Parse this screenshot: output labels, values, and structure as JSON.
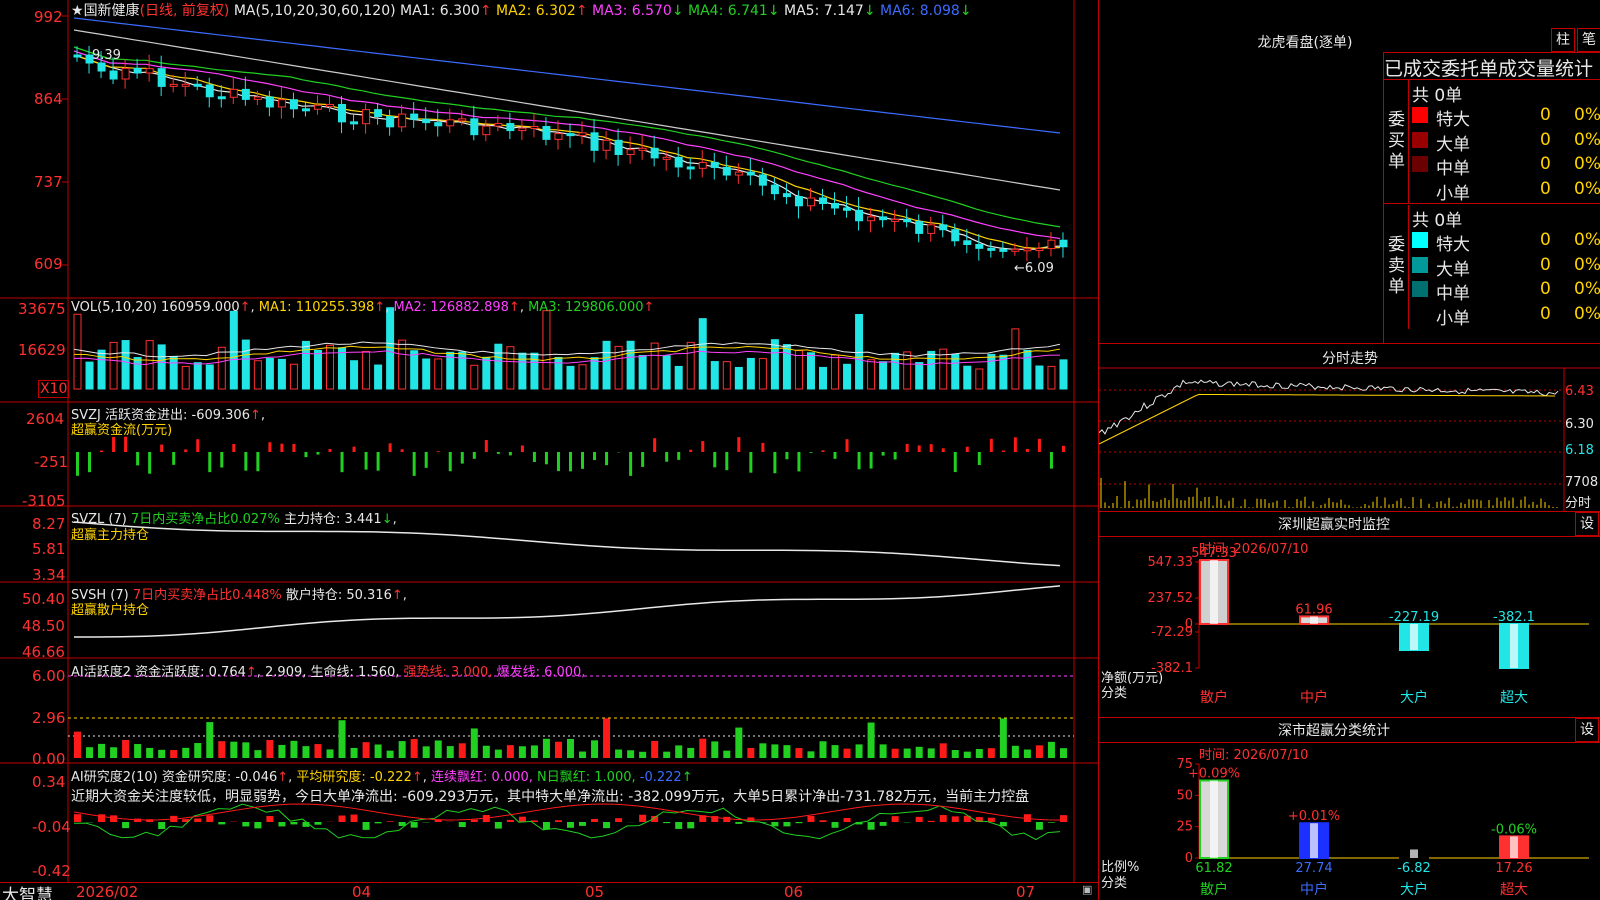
{
  "app": {
    "name": "大智慧",
    "stock_name": "国新健康",
    "period": "(日线, 前复权)"
  },
  "main_chart": {
    "ma_header": "MA(5,10,20,30,60,120)",
    "ma": [
      {
        "name": "MA1",
        "value": "6.300",
        "arrow": "↑",
        "color": "#e8e8e8"
      },
      {
        "name": "MA2",
        "value": "6.302",
        "arrow": "↑",
        "color": "#ffd400"
      },
      {
        "name": "MA3",
        "value": "6.570",
        "arrow": "↓",
        "color": "#ff40ff"
      },
      {
        "name": "MA4",
        "value": "6.741",
        "arrow": "↓",
        "color": "#21d021"
      },
      {
        "name": "MA5",
        "value": "7.147",
        "arrow": "↓",
        "color": "#e8e8e8"
      },
      {
        "name": "MA6",
        "value": "8.098",
        "arrow": "↓",
        "color": "#3c6cff"
      }
    ],
    "y_ticks": [
      "992",
      "864",
      "737",
      "609"
    ],
    "high_label": "9.39",
    "low_label": "←6.09"
  },
  "vol": {
    "header": "VOL(5,10,20)",
    "value": "160959.000",
    "ma1": "MA1: 110255.398",
    "ma2": "MA2: 126882.898",
    "ma3": "MA3: 129806.000",
    "y_ticks": [
      "33675",
      "16629"
    ],
    "unit": "X10"
  },
  "svzj": {
    "header": "SVZJ  活跃资金进出: -609.306",
    "sub": "超赢资金流(万元)",
    "y_ticks": [
      "2604",
      "-251",
      "-3105"
    ]
  },
  "svzl": {
    "header_a": "SVZL (7)",
    "header_b": "7日内买卖净占比0.027%",
    "header_c": "主力持仓: 3.441",
    "sub": "超赢主力持仓",
    "y_ticks": [
      "8.27",
      "5.81",
      "3.34"
    ]
  },
  "svsh": {
    "header_a": "SVSH (7)",
    "header_b": "7日内买卖净占比0.448%",
    "header_c": "散户持仓: 50.316",
    "sub": "超赢散户持仓",
    "y_ticks": [
      "50.40",
      "48.50",
      "46.66"
    ]
  },
  "ai_active": {
    "header_a": "AI活跃度2 资金活跃度: 0.764",
    "header_b": "2.909,",
    "header_c": "生命线: 1.560,",
    "header_d": "强势线: 3.000,",
    "header_e": "爆发线: 6.000,",
    "y_ticks": [
      "6.00",
      "2.96",
      "0.00"
    ]
  },
  "ai_research": {
    "header_a": "AI研究度2(10) 资金研究度: -0.046",
    "header_b": "平均研究度: -0.222",
    "header_c": "连续飘红: 0.000,",
    "header_d": "N日飘红: 1.000,",
    "header_e": "-0.222",
    "comment": "近期大资金关注度较低，明显弱势，今日大单净流出: -609.293万元，其中特大单净流出: -382.099万元，大单5日累计净出-731.782万元，当前主力控盘",
    "y_ticks": [
      "0.34",
      "-0.04",
      "-0.42"
    ]
  },
  "x_axis": [
    "2026/02",
    "04",
    "05",
    "06",
    "07"
  ],
  "longhu": {
    "title": "龙虎看盘(逐单)",
    "btn_zhu": "柱",
    "btn_bi": "笔",
    "subtitle": "已成交委托单成交量统计",
    "buy_label": "委买单",
    "sell_label": "委卖单",
    "buy_total": "共 0单",
    "sell_total": "共 0单",
    "buy_rows": [
      {
        "name": "特大",
        "count": "0",
        "pct": "0%",
        "color": "#ff0000"
      },
      {
        "name": "大单",
        "count": "0",
        "pct": "0%",
        "color": "#9a0000"
      },
      {
        "name": "中单",
        "count": "0",
        "pct": "0%",
        "color": "#6a0000"
      },
      {
        "name": "小单",
        "count": "0",
        "pct": "0%",
        "color": "#000000"
      }
    ],
    "sell_rows": [
      {
        "name": "特大",
        "count": "0",
        "pct": "0%",
        "color": "#00ffff"
      },
      {
        "name": "大单",
        "count": "0",
        "pct": "0%",
        "color": "#009a9a"
      },
      {
        "name": "中单",
        "count": "0",
        "pct": "0%",
        "color": "#007070"
      },
      {
        "name": "小单",
        "count": "0",
        "pct": "0%",
        "color": "#000000"
      }
    ]
  },
  "intraday": {
    "title": "分时走势",
    "y_ticks": [
      "6.43",
      "6.30",
      "6.18"
    ],
    "vol_tick": "7708",
    "vol_unit": "分时"
  },
  "sz_monitor": {
    "title": "深圳超赢实时监控",
    "btn": "设",
    "time": "时间: 2026/07/10",
    "y_ticks": [
      "547.33",
      "237.52",
      "0",
      "-72.29",
      "-382.1"
    ],
    "unit": "净额(万元)",
    "cat_label": "分类",
    "chart_data": {
      "type": "bar",
      "categories": [
        "散户",
        "中户",
        "大户",
        "超大"
      ],
      "values": [
        547.33,
        61.96,
        -227.19,
        -382.1
      ],
      "value_labels": [
        "547.33",
        "61.96",
        "-227.19",
        "-382.1"
      ],
      "ylim": [
        -382.1,
        547.33
      ]
    }
  },
  "sz_class": {
    "title": "深市超赢分类统计",
    "btn": "设",
    "time": "时间: 2026/07/10",
    "y_ticks": [
      "75",
      "50",
      "25",
      "0"
    ],
    "unit": "比例%",
    "cat_label": "分类",
    "chart_data": {
      "type": "bar",
      "categories": [
        "散户",
        "中户",
        "大户",
        "超大"
      ],
      "values": [
        61.82,
        27.74,
        -6.82,
        17.26
      ],
      "value_labels": [
        "61.82",
        "27.74",
        "-6.82",
        "17.26"
      ],
      "change_labels": [
        "+0.09%",
        "+0.01%",
        "",
        "-0.06%"
      ],
      "ylim": [
        0,
        75
      ]
    }
  },
  "colors": {
    "up": "#ff3030",
    "down": "#22e6e6",
    "grid": "#c00000",
    "bg": "#000000"
  }
}
